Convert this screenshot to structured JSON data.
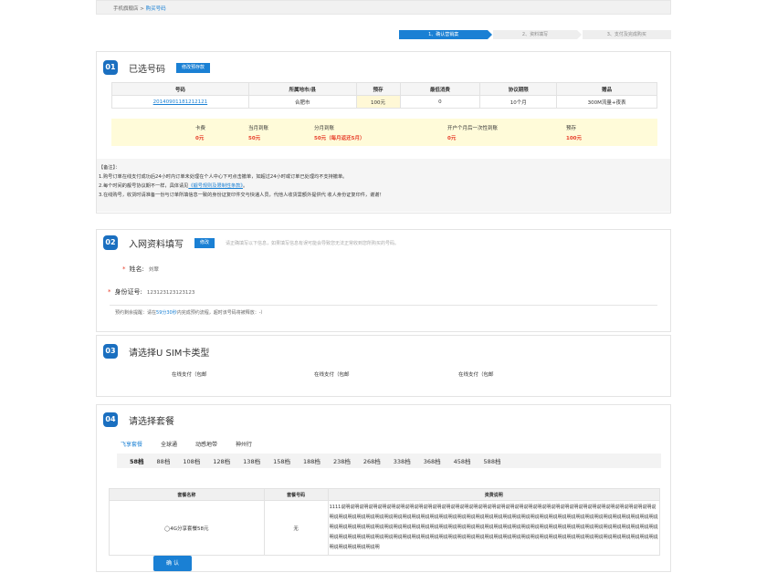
{
  "breadcrumb": {
    "home": "手机旗舰店",
    "sep": ">",
    "current": "购买号码"
  },
  "steps": [
    "1、确认营销案",
    "2、资料填写",
    "3、支付及完成购买"
  ],
  "section1": {
    "num": "01",
    "title": "已选号码",
    "edit_btn": "修改预存款",
    "headers": [
      "号码",
      "所属地市/县",
      "预存",
      "最低消费",
      "协议期限",
      "赠品"
    ],
    "row": [
      "20140901181212121",
      "合肥市",
      "100元",
      "0",
      "10个月",
      "300M流量+夜表"
    ],
    "fees": [
      {
        "label": "卡费",
        "value": "0元"
      },
      {
        "label": "当月到账",
        "value": "50元"
      },
      {
        "label": "分月到账",
        "value": "50元（每月返还5月）"
      },
      {
        "label": "开户个月后一次性到账",
        "value": "0元"
      },
      {
        "label": "预存",
        "value": "100元"
      }
    ]
  },
  "notes": {
    "title": "【备注】：",
    "line1": "1.购号订单在线支付成功后24小时内订单未处理在个人中心下可点击撤单，如超过24小时或订单已处理均不支持撤单。",
    "line2_pre": "2.每个时间的靓号协议期不一样，具体请见",
    "line2_link": "《靓号规则及限制性条款》",
    "line2_post": "。",
    "line3": "3.在线购号，收货时请准备一份与订单所填信息一致的身份证复印件交与快递人员，代他人收货需额外提供代 收人身份证复印件，谢谢！"
  },
  "section2": {
    "num": "02",
    "title": "入网资料填写",
    "edit_btn": "修改",
    "hint": "请正确填写以下信息，如果填写信息有误可能会导致您无法正常收到您所购买的号码。",
    "name_label": "姓名:",
    "name_value": "刘翠",
    "id_label": "身份证号:",
    "id_value": "123123123123123",
    "remind_pre": "预约剩余提醒：请在",
    "remind_time": "59分30秒",
    "remind_post": "内完成预约流程，超时该号码将被释放：-）"
  },
  "section3": {
    "num": "03",
    "title": "请选择U SIM卡类型",
    "options": [
      "在线支付（包邮",
      "在线支付（包邮",
      "在线支付（包邮"
    ]
  },
  "section4": {
    "num": "04",
    "title": "请选择套餐",
    "tabs": [
      "飞享套餐",
      "全球通",
      "动感地带",
      "神州行"
    ],
    "levels": [
      "58档",
      "88档",
      "108档",
      "128档",
      "138档",
      "158档",
      "188档",
      "238档",
      "268档",
      "338档",
      "368档",
      "458档",
      "588档"
    ],
    "headers": [
      "套餐名称",
      "套餐号码",
      "资费说明"
    ],
    "row": {
      "name": "◯4G分享套餐58元",
      "number": "无",
      "desc": "1111说明说明说明说明说明说明说明说明说明说明说明说明说明说明说明说明说明说明说明说明说明说明说明说明说明说明说明说明说明说明说明说明说明说明说明说明说明说明说明说明说明说明说明说明说明说明说明说明说明说明说明说明说明说明说明说明说明说明说明说明说明说明说明说明说明说明说明说明说明说明说明说明说明说明说明说明说明说明说明说明说明说明说明说明说明说明说明说明说明说明说明说明说明说明说明说明说明说明说明说明说明说明说明说明说明说明说明说明说明说明说明说明说明说明说明说明说明说明说明说明说明说明说明说明说明说明说明说明说明说明说明说明说明说明说明说明说明说明说明说明说明说明说明说明说明说明说明说明"
    },
    "confirm": "确 认"
  },
  "colors": {
    "accent": "#1a80d4",
    "price": "#e8402c",
    "highlight": "#fffbd9"
  }
}
